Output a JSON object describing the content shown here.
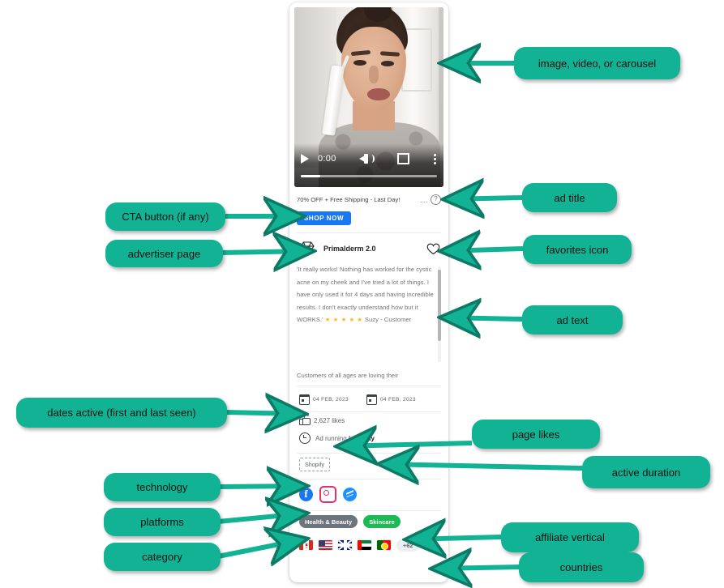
{
  "card": {
    "video": {
      "play_label": "play",
      "time": "0:00",
      "volume_label": "volume",
      "fullscreen_label": "fullscreen",
      "menu_label": "more options"
    },
    "ad_title": "70% OFF + Free Shipping - Last Day!",
    "ellipsis": "...",
    "help_icon_label": "?",
    "cta_label": "SHOP NOW",
    "advertiser_name": "Primalderm 2.0",
    "advertiser_logo": "diamond-icon",
    "favorite_icon": "heart-icon",
    "ad_text_part1": "'It really works! Nothing has worked for the cystic acne on my cheek and I've tried a lot of things. I have only used it for 4 days and having incredible results. I don't exactly understand how but it WORKS.' ",
    "ad_text_stars": "★ ★ ★ ★ ★",
    "ad_text_part2": " Suzy - Customer",
    "ad_text_more": "Customers of all ages are loving their",
    "date_first_seen": "04 FEB, 2023",
    "date_last_seen": "04 FEB, 2023",
    "likes": "2,627 likes",
    "duration_prefix": "Ad running for ",
    "duration_value": "1 day",
    "technology": "Shopify",
    "platforms": [
      "facebook-icon",
      "instagram-icon",
      "messenger-icon"
    ],
    "category_tag": "Health & Beauty",
    "vertical_tag": "Skincare",
    "countries": [
      "canada-flag",
      "usa-flag",
      "uk-flag",
      "uae-flag",
      "portugal-flag"
    ],
    "countries_more": "+62"
  },
  "annotations": {
    "media": "image, video, or carousel",
    "ad_title": "ad title",
    "cta": "CTA button (if any)",
    "advertiser": "advertiser page",
    "favorites": "favorites icon",
    "ad_text": "ad text",
    "dates": "dates active (first and last seen)",
    "likes": "page likes",
    "duration": "active duration",
    "technology": "technology",
    "platforms": "platforms",
    "vertical": "affiliate vertical",
    "category": "category",
    "countries": "countries"
  },
  "colors": {
    "accent": "#12B394",
    "cta": "#1877F2",
    "tag_grey": "#6c757d",
    "tag_green": "#1DB954",
    "star": "#f7b928"
  }
}
